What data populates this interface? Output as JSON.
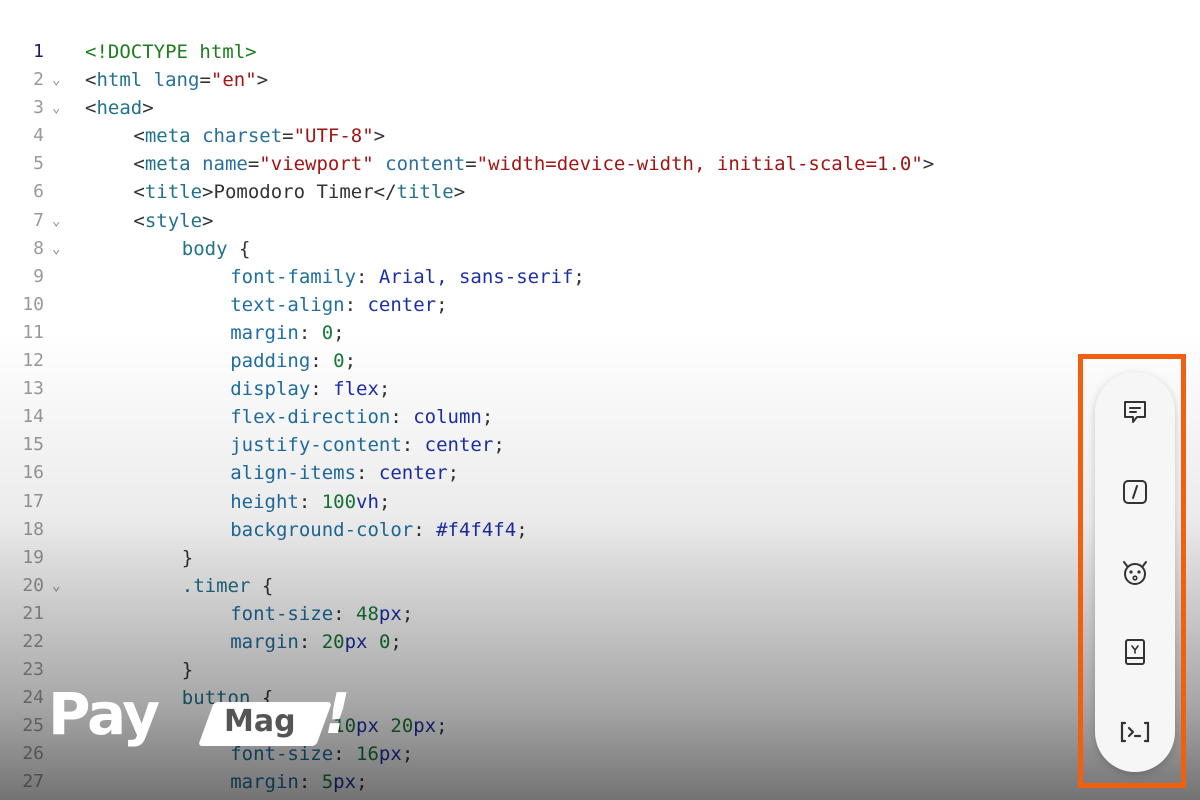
{
  "editor": {
    "lines": [
      {
        "n": "1",
        "indent": 0,
        "fold": false,
        "tokens": [
          {
            "c": "tok-doctype",
            "t": "<!DOCTYPE html>"
          }
        ]
      },
      {
        "n": "2",
        "indent": 0,
        "fold": true,
        "tokens": [
          {
            "c": "tok-punc",
            "t": "<"
          },
          {
            "c": "tok-tag",
            "t": "html"
          },
          {
            "c": "tok-punc",
            "t": " "
          },
          {
            "c": "tok-attr",
            "t": "lang"
          },
          {
            "c": "tok-punc",
            "t": "="
          },
          {
            "c": "tok-str",
            "t": "\"en\""
          },
          {
            "c": "tok-punc",
            "t": ">"
          }
        ]
      },
      {
        "n": "3",
        "indent": 0,
        "fold": true,
        "tokens": [
          {
            "c": "tok-punc",
            "t": "<"
          },
          {
            "c": "tok-tag",
            "t": "head"
          },
          {
            "c": "tok-punc",
            "t": ">"
          }
        ]
      },
      {
        "n": "4",
        "indent": 4,
        "fold": false,
        "tokens": [
          {
            "c": "tok-punc",
            "t": "<"
          },
          {
            "c": "tok-tag",
            "t": "meta"
          },
          {
            "c": "tok-punc",
            "t": " "
          },
          {
            "c": "tok-attr",
            "t": "charset"
          },
          {
            "c": "tok-punc",
            "t": "="
          },
          {
            "c": "tok-str",
            "t": "\"UTF-8\""
          },
          {
            "c": "tok-punc",
            "t": ">"
          }
        ]
      },
      {
        "n": "5",
        "indent": 4,
        "fold": false,
        "tokens": [
          {
            "c": "tok-punc",
            "t": "<"
          },
          {
            "c": "tok-tag",
            "t": "meta"
          },
          {
            "c": "tok-punc",
            "t": " "
          },
          {
            "c": "tok-attr",
            "t": "name"
          },
          {
            "c": "tok-punc",
            "t": "="
          },
          {
            "c": "tok-str",
            "t": "\"viewport\""
          },
          {
            "c": "tok-punc",
            "t": " "
          },
          {
            "c": "tok-attr",
            "t": "content"
          },
          {
            "c": "tok-punc",
            "t": "="
          },
          {
            "c": "tok-str",
            "t": "\"width=device-width, initial-scale=1.0\""
          },
          {
            "c": "tok-punc",
            "t": ">"
          }
        ]
      },
      {
        "n": "6",
        "indent": 4,
        "fold": false,
        "tokens": [
          {
            "c": "tok-punc",
            "t": "<"
          },
          {
            "c": "tok-tag",
            "t": "title"
          },
          {
            "c": "tok-punc",
            "t": ">"
          },
          {
            "c": "tok-text",
            "t": "Pomodoro Timer"
          },
          {
            "c": "tok-punc",
            "t": "</"
          },
          {
            "c": "tok-tag",
            "t": "title"
          },
          {
            "c": "tok-punc",
            "t": ">"
          }
        ]
      },
      {
        "n": "7",
        "indent": 4,
        "fold": true,
        "tokens": [
          {
            "c": "tok-punc",
            "t": "<"
          },
          {
            "c": "tok-tag",
            "t": "style"
          },
          {
            "c": "tok-punc",
            "t": ">"
          }
        ]
      },
      {
        "n": "8",
        "indent": 8,
        "fold": true,
        "tokens": [
          {
            "c": "tok-sel",
            "t": "body"
          },
          {
            "c": "tok-punc",
            "t": " {"
          }
        ]
      },
      {
        "n": "9",
        "indent": 12,
        "fold": false,
        "tokens": [
          {
            "c": "tok-prop",
            "t": "font-family"
          },
          {
            "c": "tok-punc",
            "t": ": "
          },
          {
            "c": "tok-val",
            "t": "Arial, sans-serif"
          },
          {
            "c": "tok-punc",
            "t": ";"
          }
        ]
      },
      {
        "n": "10",
        "indent": 12,
        "fold": false,
        "tokens": [
          {
            "c": "tok-prop",
            "t": "text-align"
          },
          {
            "c": "tok-punc",
            "t": ": "
          },
          {
            "c": "tok-val",
            "t": "center"
          },
          {
            "c": "tok-punc",
            "t": ";"
          }
        ]
      },
      {
        "n": "11",
        "indent": 12,
        "fold": false,
        "tokens": [
          {
            "c": "tok-prop",
            "t": "margin"
          },
          {
            "c": "tok-punc",
            "t": ": "
          },
          {
            "c": "tok-num",
            "t": "0"
          },
          {
            "c": "tok-punc",
            "t": ";"
          }
        ]
      },
      {
        "n": "12",
        "indent": 12,
        "fold": false,
        "tokens": [
          {
            "c": "tok-prop",
            "t": "padding"
          },
          {
            "c": "tok-punc",
            "t": ": "
          },
          {
            "c": "tok-num",
            "t": "0"
          },
          {
            "c": "tok-punc",
            "t": ";"
          }
        ]
      },
      {
        "n": "13",
        "indent": 12,
        "fold": false,
        "tokens": [
          {
            "c": "tok-prop",
            "t": "display"
          },
          {
            "c": "tok-punc",
            "t": ": "
          },
          {
            "c": "tok-val",
            "t": "flex"
          },
          {
            "c": "tok-punc",
            "t": ";"
          }
        ]
      },
      {
        "n": "14",
        "indent": 12,
        "fold": false,
        "tokens": [
          {
            "c": "tok-prop",
            "t": "flex-direction"
          },
          {
            "c": "tok-punc",
            "t": ": "
          },
          {
            "c": "tok-val",
            "t": "column"
          },
          {
            "c": "tok-punc",
            "t": ";"
          }
        ]
      },
      {
        "n": "15",
        "indent": 12,
        "fold": false,
        "tokens": [
          {
            "c": "tok-prop",
            "t": "justify-content"
          },
          {
            "c": "tok-punc",
            "t": ": "
          },
          {
            "c": "tok-val",
            "t": "center"
          },
          {
            "c": "tok-punc",
            "t": ";"
          }
        ]
      },
      {
        "n": "16",
        "indent": 12,
        "fold": false,
        "tokens": [
          {
            "c": "tok-prop",
            "t": "align-items"
          },
          {
            "c": "tok-punc",
            "t": ": "
          },
          {
            "c": "tok-val",
            "t": "center"
          },
          {
            "c": "tok-punc",
            "t": ";"
          }
        ]
      },
      {
        "n": "17",
        "indent": 12,
        "fold": false,
        "tokens": [
          {
            "c": "tok-prop",
            "t": "height"
          },
          {
            "c": "tok-punc",
            "t": ": "
          },
          {
            "c": "tok-num",
            "t": "100"
          },
          {
            "c": "tok-unit",
            "t": "vh"
          },
          {
            "c": "tok-punc",
            "t": ";"
          }
        ]
      },
      {
        "n": "18",
        "indent": 12,
        "fold": false,
        "tokens": [
          {
            "c": "tok-prop",
            "t": "background-color"
          },
          {
            "c": "tok-punc",
            "t": ": "
          },
          {
            "c": "tok-val",
            "t": "#f4f4f4"
          },
          {
            "c": "tok-punc",
            "t": ";"
          }
        ]
      },
      {
        "n": "19",
        "indent": 8,
        "fold": false,
        "tokens": [
          {
            "c": "tok-punc",
            "t": "}"
          }
        ]
      },
      {
        "n": "20",
        "indent": 8,
        "fold": true,
        "tokens": [
          {
            "c": "tok-sel",
            "t": ".timer"
          },
          {
            "c": "tok-punc",
            "t": " {"
          }
        ]
      },
      {
        "n": "21",
        "indent": 12,
        "fold": false,
        "tokens": [
          {
            "c": "tok-prop",
            "t": "font-size"
          },
          {
            "c": "tok-punc",
            "t": ": "
          },
          {
            "c": "tok-num",
            "t": "48"
          },
          {
            "c": "tok-unit",
            "t": "px"
          },
          {
            "c": "tok-punc",
            "t": ";"
          }
        ]
      },
      {
        "n": "22",
        "indent": 12,
        "fold": false,
        "tokens": [
          {
            "c": "tok-prop",
            "t": "margin"
          },
          {
            "c": "tok-punc",
            "t": ": "
          },
          {
            "c": "tok-num",
            "t": "20"
          },
          {
            "c": "tok-unit",
            "t": "px"
          },
          {
            "c": "tok-punc",
            "t": " "
          },
          {
            "c": "tok-num",
            "t": "0"
          },
          {
            "c": "tok-punc",
            "t": ";"
          }
        ]
      },
      {
        "n": "23",
        "indent": 8,
        "fold": false,
        "tokens": [
          {
            "c": "tok-punc",
            "t": "}"
          }
        ]
      },
      {
        "n": "24",
        "indent": 8,
        "fold": true,
        "tokens": [
          {
            "c": "tok-sel",
            "t": "button"
          },
          {
            "c": "tok-punc",
            "t": " {"
          }
        ]
      },
      {
        "n": "25",
        "indent": 12,
        "fold": false,
        "tokens": [
          {
            "c": "tok-prop",
            "t": "padding"
          },
          {
            "c": "tok-punc",
            "t": ": "
          },
          {
            "c": "tok-num",
            "t": "10"
          },
          {
            "c": "tok-unit",
            "t": "px"
          },
          {
            "c": "tok-punc",
            "t": " "
          },
          {
            "c": "tok-num",
            "t": "20"
          },
          {
            "c": "tok-unit",
            "t": "px"
          },
          {
            "c": "tok-punc",
            "t": ";"
          }
        ]
      },
      {
        "n": "26",
        "indent": 12,
        "fold": false,
        "tokens": [
          {
            "c": "tok-prop",
            "t": "font-size"
          },
          {
            "c": "tok-punc",
            "t": ": "
          },
          {
            "c": "tok-num",
            "t": "16"
          },
          {
            "c": "tok-unit",
            "t": "px"
          },
          {
            "c": "tok-punc",
            "t": ";"
          }
        ]
      },
      {
        "n": "27",
        "indent": 12,
        "fold": false,
        "tokens": [
          {
            "c": "tok-prop",
            "t": "margin"
          },
          {
            "c": "tok-punc",
            "t": ": "
          },
          {
            "c": "tok-num",
            "t": "5"
          },
          {
            "c": "tok-unit",
            "t": "px"
          },
          {
            "c": "tok-punc",
            "t": ";"
          }
        ]
      }
    ]
  },
  "toolbar": {
    "buttons": [
      {
        "name": "chat-icon"
      },
      {
        "name": "slash-command-icon"
      },
      {
        "name": "bug-icon"
      },
      {
        "name": "book-icon"
      },
      {
        "name": "terminal-icon"
      }
    ],
    "highlight_color": "#f0600f"
  },
  "watermark": {
    "pay": "Pay",
    "mag": "Mag",
    "bang": "!"
  }
}
